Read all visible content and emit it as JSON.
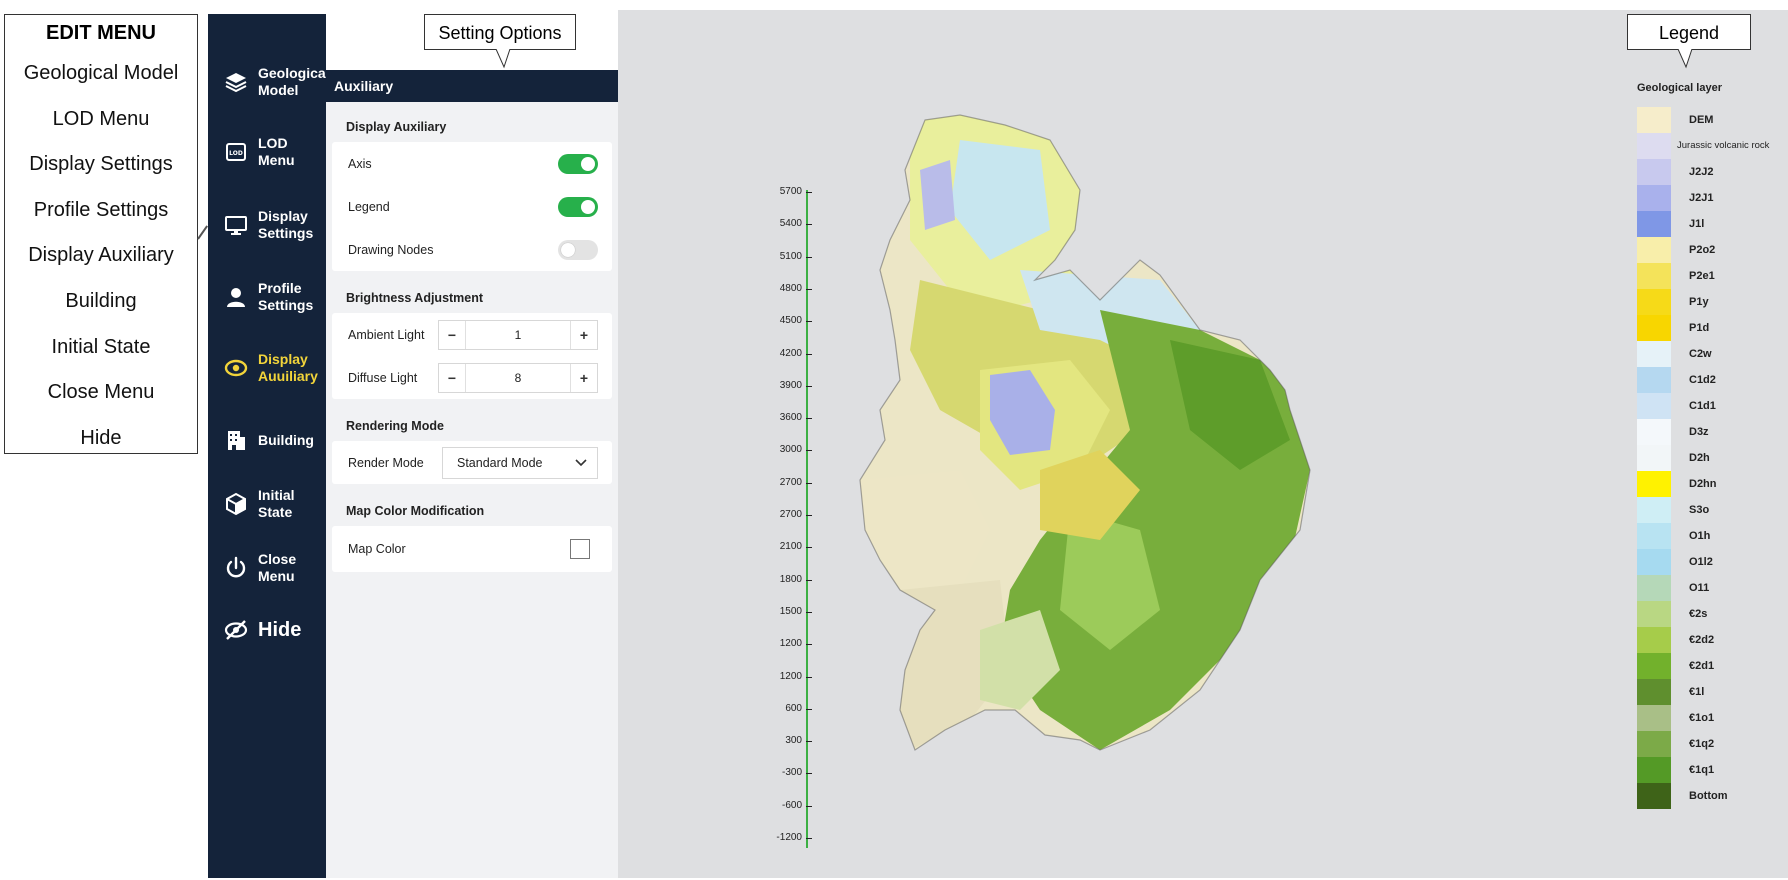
{
  "edit_menu": {
    "title": "EDIT MENU",
    "items": [
      "Geological Model",
      "LOD Menu",
      "Display Settings",
      "Profile Settings",
      "Display Auxiliary",
      "Building",
      "Initial State",
      "Close Menu",
      "Hide"
    ]
  },
  "sidebar": {
    "items": [
      {
        "label": "Geological Model",
        "icon": "layers-icon"
      },
      {
        "label": "LOD Menu",
        "icon": "lod-icon"
      },
      {
        "label": "Display Settings",
        "icon": "monitor-icon"
      },
      {
        "label": "Profile Settings",
        "icon": "user-icon"
      },
      {
        "label": "Display Auuiliary",
        "icon": "eye-icon",
        "active": true
      },
      {
        "label": "Building",
        "icon": "building-icon"
      },
      {
        "label": "Initial State",
        "icon": "cube-icon"
      },
      {
        "label": "Close Menu",
        "icon": "power-icon"
      },
      {
        "label": "Hide",
        "icon": "eye-slash-icon"
      }
    ]
  },
  "callouts": {
    "setting_options": "Setting Options",
    "legend": "Legend"
  },
  "panel": {
    "header": "Auxiliary",
    "display_auxiliary": {
      "title": "Display Auxiliary",
      "axis": {
        "label": "Axis",
        "on": true
      },
      "legend": {
        "label": "Legend",
        "on": true
      },
      "drawing_nodes": {
        "label": "Drawing Nodes",
        "on": false
      }
    },
    "brightness": {
      "title": "Brightness Adjustment",
      "ambient": {
        "label": "Ambient Light",
        "value": "1"
      },
      "diffuse": {
        "label": "Diffuse Light",
        "value": "8"
      },
      "minus": "−",
      "plus": "+"
    },
    "rendering": {
      "title": "Rendering Mode",
      "label": "Render Mode",
      "value": "Standard Mode"
    },
    "map_color": {
      "title": "Map Color Modification",
      "label": "Map Color",
      "checked": false
    }
  },
  "axis": {
    "ticks": [
      "5700",
      "5400",
      "5100",
      "4800",
      "4500",
      "4200",
      "3900",
      "3600",
      "3000",
      "2700",
      "2700",
      "2100",
      "1800",
      "1500",
      "1200",
      "1200",
      "600",
      "300",
      "-300",
      "-600",
      "-1200"
    ]
  },
  "legend": {
    "title": "Geological layer",
    "items": [
      {
        "label": "DEM",
        "color": "#f6edcb"
      },
      {
        "label": "Jurassic volcanic rock",
        "color": "#dddcf0"
      },
      {
        "label": "J2J2",
        "color": "#c8c9ee"
      },
      {
        "label": "J2J1",
        "color": "#a9b1ec"
      },
      {
        "label": "J1l",
        "color": "#7f97e6"
      },
      {
        "label": "P2o2",
        "color": "#f8eeaa"
      },
      {
        "label": "P2e1",
        "color": "#f4e35a"
      },
      {
        "label": "P1y",
        "color": "#f6da18"
      },
      {
        "label": "P1d",
        "color": "#f8d600"
      },
      {
        "label": "C2w",
        "color": "#e6f2f8"
      },
      {
        "label": "C1d2",
        "color": "#b5d8f0"
      },
      {
        "label": "C1d1",
        "color": "#cfe3f4"
      },
      {
        "label": "D3z",
        "color": "#f4f8fb"
      },
      {
        "label": "D2h",
        "color": "#f2f6f8"
      },
      {
        "label": "D2hn",
        "color": "#fff200"
      },
      {
        "label": "S3o",
        "color": "#cfeef5"
      },
      {
        "label": "O1h",
        "color": "#b8e3f2"
      },
      {
        "label": "O1l2",
        "color": "#a6daf0"
      },
      {
        "label": "O11",
        "color": "#b5d8b8"
      },
      {
        "label": "€2s",
        "color": "#b9d783"
      },
      {
        "label": "€2d2",
        "color": "#a6cc4a"
      },
      {
        "label": "€2d1",
        "color": "#72b12c"
      },
      {
        "label": "€1l",
        "color": "#5f8f2e"
      },
      {
        "label": "€1o1",
        "color": "#a9bf87"
      },
      {
        "label": "€1q2",
        "color": "#7caa48"
      },
      {
        "label": "€1q1",
        "color": "#549a26"
      },
      {
        "label": "Bottom",
        "color": "#3e6318"
      }
    ]
  }
}
